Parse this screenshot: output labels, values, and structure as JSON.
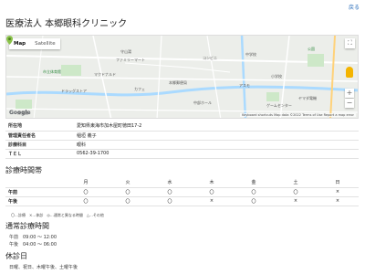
{
  "header": {
    "back_link": "戻る",
    "title": "医療法人 本郷眼科クリニック"
  },
  "map": {
    "tabs": [
      {
        "label": "Map"
      },
      {
        "label": "Satellite"
      }
    ],
    "zoom_in": "+",
    "zoom_out": "−",
    "logo": "Google",
    "footer": "Keyboard shortcuts   Map data ©2022   Terms of Use   Report a map error",
    "labels": [
      "市立体育館",
      "守山湯",
      "ファミリーマート",
      "中学校",
      "本郷郵便局",
      "マクドナルド",
      "コンビニ",
      "カフェ",
      "中部ホール",
      "公園",
      "小学校",
      "ゲームセンター",
      "ヤマダ電機",
      "保育園",
      "ドラッグストア",
      "アスモ"
    ]
  },
  "info": {
    "rows": [
      {
        "key": "所在地",
        "value": "愛知県東海市加木屋町徳田17-2"
      },
      {
        "key": "管理責任者名",
        "value": "稲垣 義子"
      },
      {
        "key": "診療科目",
        "value": "眼科"
      },
      {
        "key": "ＴＥＬ",
        "value": "0562-39-1700"
      }
    ]
  },
  "schedule": {
    "heading": "診療時間帯",
    "days": [
      "月",
      "火",
      "水",
      "木",
      "金",
      "土",
      "日"
    ],
    "rows": [
      {
        "label": "午前",
        "cells": [
          "〇",
          "〇",
          "〇",
          "〇",
          "〇",
          "〇",
          "×"
        ]
      },
      {
        "label": "午後",
        "cells": [
          "〇",
          "〇",
          "〇",
          "×",
          "〇",
          "×",
          "×"
        ]
      }
    ],
    "legend": "〇…診療　×…休診　◎…通常と異なる時間　△…その他"
  },
  "hours": {
    "heading": "通常診療時間",
    "am": "午前　09:00 〜 12:00",
    "pm": "午後　04:00 〜 06:00"
  },
  "holidays": {
    "heading": "休診日",
    "text": "日曜、祝日、木曜午後、土曜午後"
  },
  "colors": {
    "link": "#2a6ebb",
    "marker": "#8bc34a",
    "river": "#aadaff"
  }
}
